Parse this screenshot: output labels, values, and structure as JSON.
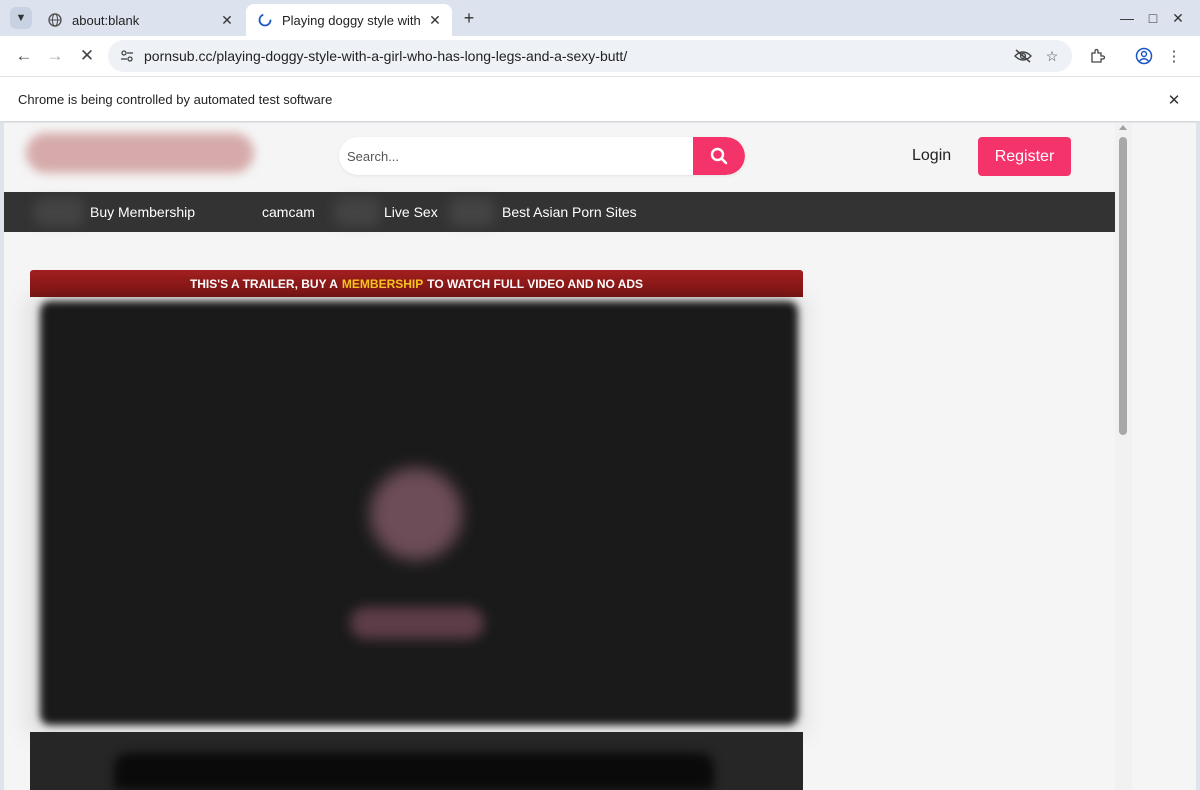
{
  "browser": {
    "tabs": [
      {
        "title": "about:blank",
        "icon": "globe-icon",
        "active": false
      },
      {
        "title": "Playing doggy style with",
        "icon": "loading-icon",
        "active": true
      }
    ],
    "url": "pornsub.cc/playing-doggy-style-with-a-girl-who-has-long-legs-and-a-sexy-butt/",
    "infobar_text": "Chrome is being controlled by automated test software"
  },
  "site": {
    "search": {
      "placeholder": "Search..."
    },
    "login_label": "Login",
    "register_label": "Register",
    "nav": [
      {
        "label": "Buy Membership"
      },
      {
        "label": "camcam"
      },
      {
        "label": "Live Sex"
      },
      {
        "label": "Best Asian Porn Sites"
      }
    ],
    "trailer_banner": {
      "prefix": "THIS'S A TRAILER, BUY A",
      "highlight": "MEMBERSHIP",
      "suffix": "TO WATCH FULL VIDEO AND NO ADS"
    }
  },
  "colors": {
    "accent": "#f5336b",
    "nav_bg": "#333333",
    "banner_red": "#a31f1f",
    "banner_highlight": "#f8c61f"
  }
}
